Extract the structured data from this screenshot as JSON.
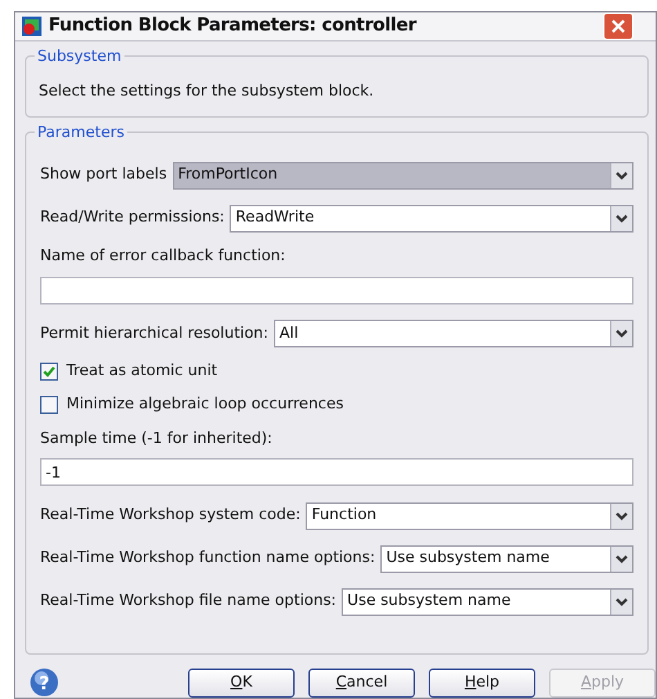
{
  "window": {
    "title": "Function Block Parameters: controller"
  },
  "subsystem": {
    "legend": "Subsystem",
    "description": "Select the settings for the subsystem block."
  },
  "parameters": {
    "legend": "Parameters",
    "items": [
      {
        "kind": "dropdown",
        "label": "Show port labels",
        "value": "FromPortIcon",
        "focused": true
      },
      {
        "kind": "dropdown",
        "label": "Read/Write permissions:",
        "value": "ReadWrite",
        "focused": false
      },
      {
        "kind": "textfield",
        "label": "Name of error callback function:"
      },
      {
        "kind": "dropdown",
        "label": "Permit hierarchical resolution:",
        "value": "All",
        "focused": false
      },
      {
        "kind": "checkbox",
        "label": "Treat as atomic unit",
        "checked": true
      },
      {
        "kind": "checkbox",
        "label": "Minimize algebraic loop occurrences",
        "checked": false
      },
      {
        "kind": "textfield",
        "label": "Sample time (-1 for inherited):",
        "value": "-1"
      },
      {
        "kind": "dropdown",
        "label": "Real-Time Workshop system code:",
        "value": "Function",
        "focused": false
      },
      {
        "kind": "dropdown",
        "label": "Real-Time Workshop function name options:",
        "value": "Use subsystem name",
        "focused": false
      },
      {
        "kind": "dropdown",
        "label": "Real-Time Workshop file name options:",
        "value": "Use subsystem name",
        "focused": false
      }
    ]
  },
  "help_glyph": "?",
  "buttons": [
    {
      "label": "OK",
      "mnemonic_underlined": true,
      "disabled": false
    },
    {
      "label": "Cancel",
      "mnemonic_underlined": true,
      "disabled": false
    },
    {
      "label": "Help",
      "mnemonic_underlined": true,
      "disabled": false
    },
    {
      "label": "Apply",
      "mnemonic_underlined": true,
      "disabled": true
    }
  ]
}
